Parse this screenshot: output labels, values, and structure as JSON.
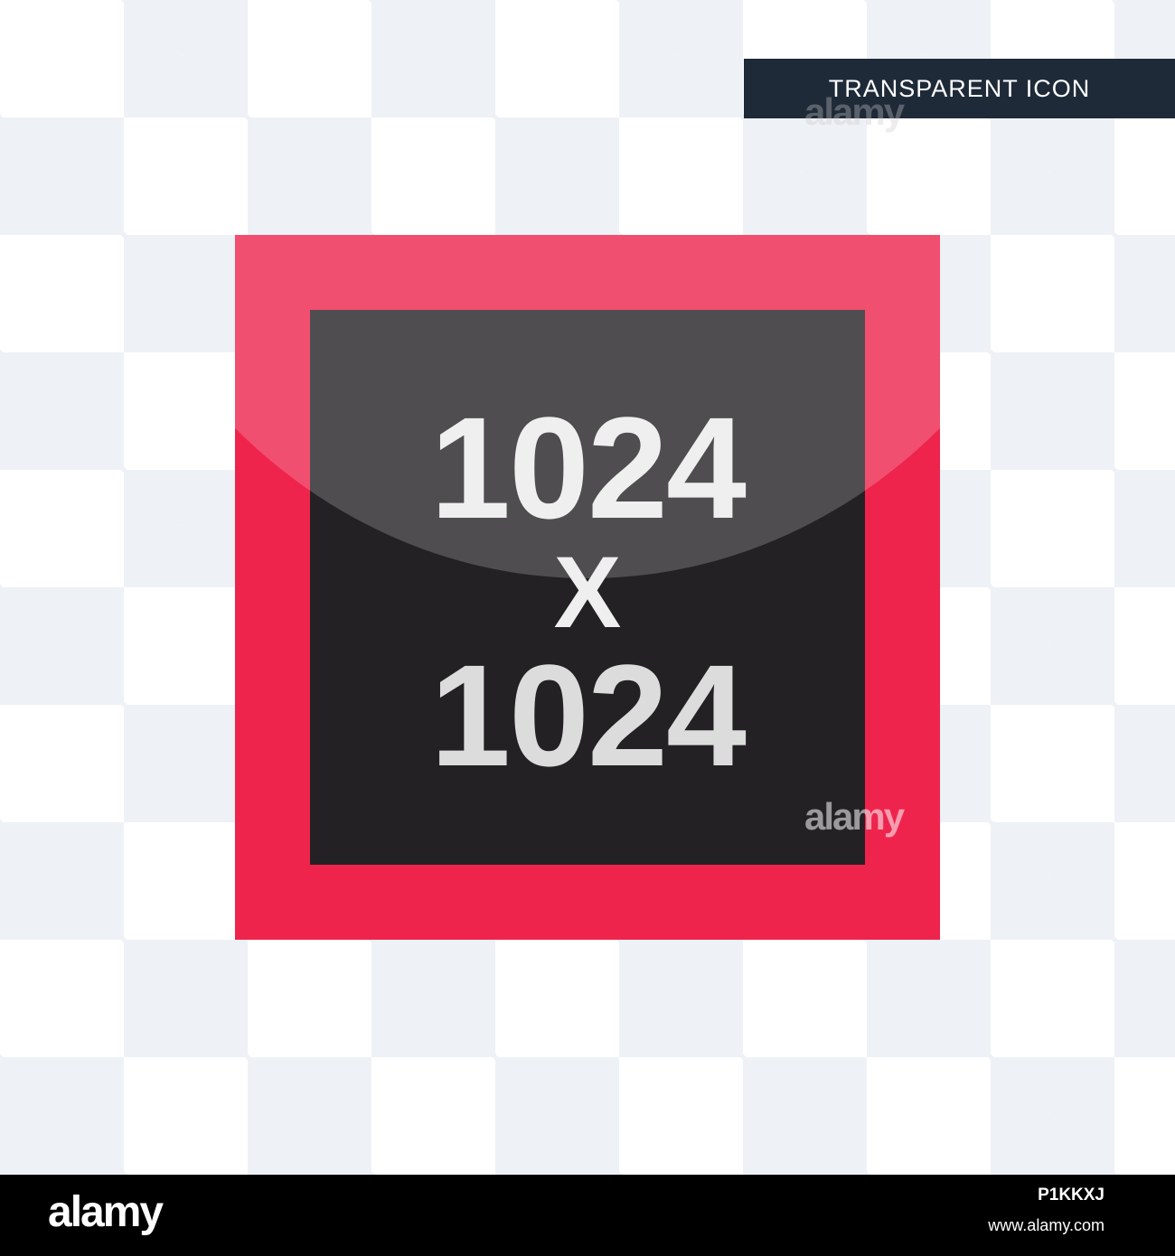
{
  "badge": {
    "label": "TRANSPARENT ICON"
  },
  "icon": {
    "line1": "1024",
    "line2": "X",
    "line3": "1024",
    "frame_color": "#ee244c",
    "inner_color": "#232123"
  },
  "watermark": {
    "text": "alamy"
  },
  "footer": {
    "logo": "alamy",
    "image_id": "P1KKXJ",
    "url": "www.alamy.com"
  }
}
